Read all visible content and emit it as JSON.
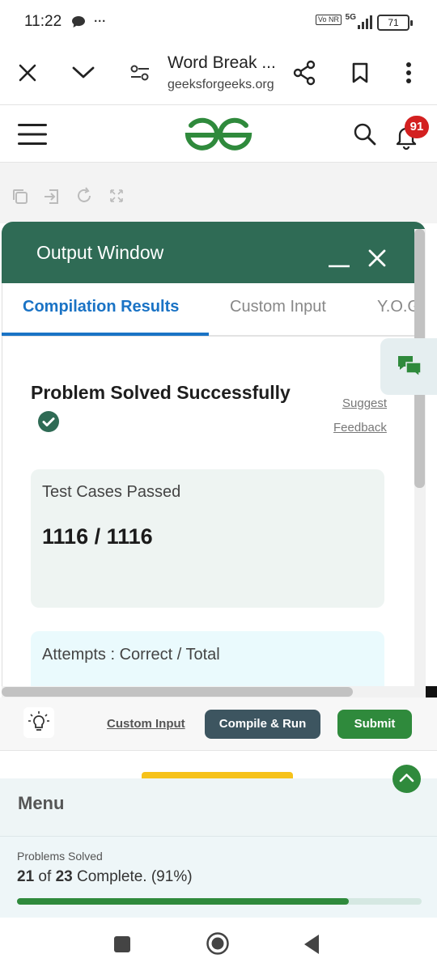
{
  "status_bar": {
    "time": "11:22",
    "dots": "···",
    "battery": "71",
    "volte": "Vo NR",
    "network": "5G"
  },
  "browser": {
    "title": "Word Break ...",
    "domain": "geeksforgeeks.org"
  },
  "header": {
    "notification_count": "91"
  },
  "output_window": {
    "title": "Output Window",
    "tabs": [
      "Compilation Results",
      "Custom Input",
      "Y.O.G.I."
    ],
    "result_title": "Problem Solved Successfully",
    "suggest": "Suggest",
    "feedback": "Feedback",
    "test_cases_label": "Test Cases Passed",
    "test_cases_value": "1116 / 1116",
    "attempts_label": "Attempts : Correct / Total"
  },
  "actions": {
    "custom_input": "Custom Input",
    "compile_run": "Compile & Run",
    "submit": "Submit"
  },
  "menu": {
    "title": "Menu",
    "problems_solved_label": "Problems Solved",
    "solved": "21",
    "of": "of",
    "total": "23",
    "complete_text": "Complete. (91%)",
    "progress_fraction": 0.91
  },
  "colors": {
    "brand_green": "#2f8a3c",
    "window_green": "#2f6b55",
    "tab_blue": "#1a73c5",
    "badge_red": "#d32020"
  }
}
